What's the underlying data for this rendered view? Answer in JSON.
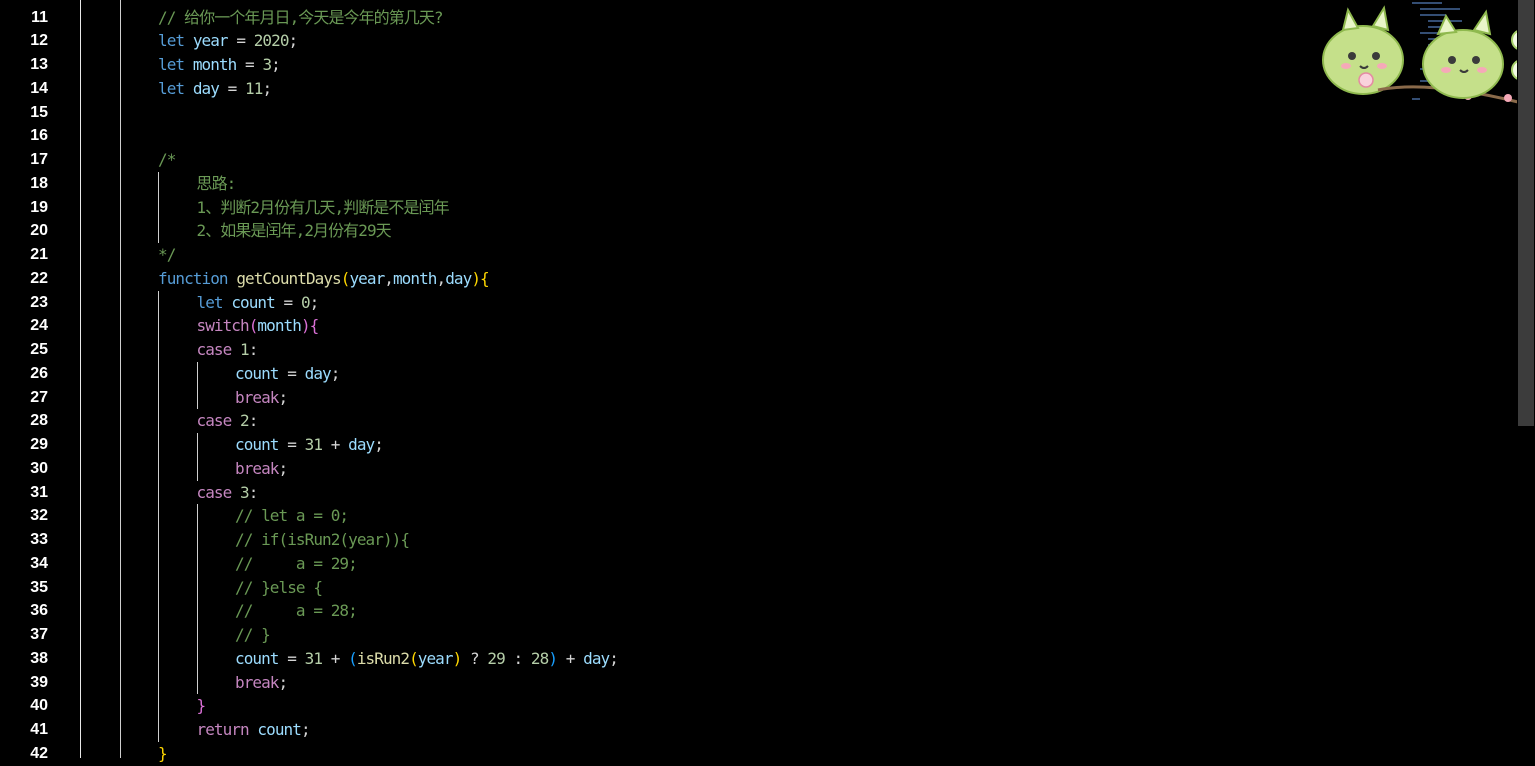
{
  "editor": {
    "line_numbers": [
      "11",
      "12",
      "13",
      "14",
      "15",
      "16",
      "17",
      "18",
      "19",
      "20",
      "21",
      "22",
      "23",
      "24",
      "25",
      "26",
      "27",
      "28",
      "29",
      "30",
      "31",
      "32",
      "33",
      "34",
      "35",
      "36",
      "37",
      "38",
      "39",
      "40",
      "41",
      "42"
    ],
    "lines": [
      {
        "indent": 2,
        "tokens": [
          {
            "t": "cm",
            "v": "// 给你一个年月日,今天是今年的第几天?"
          }
        ]
      },
      {
        "indent": 2,
        "tokens": [
          {
            "t": "kw",
            "v": "let"
          },
          {
            "t": "pl",
            "v": " "
          },
          {
            "t": "var",
            "v": "year"
          },
          {
            "t": "op",
            "v": " = "
          },
          {
            "t": "num",
            "v": "2020"
          },
          {
            "t": "op",
            "v": ";"
          }
        ]
      },
      {
        "indent": 2,
        "tokens": [
          {
            "t": "kw",
            "v": "let"
          },
          {
            "t": "pl",
            "v": " "
          },
          {
            "t": "var",
            "v": "month"
          },
          {
            "t": "op",
            "v": " = "
          },
          {
            "t": "num",
            "v": "3"
          },
          {
            "t": "op",
            "v": ";"
          }
        ]
      },
      {
        "indent": 2,
        "tokens": [
          {
            "t": "kw",
            "v": "let"
          },
          {
            "t": "pl",
            "v": " "
          },
          {
            "t": "var",
            "v": "day"
          },
          {
            "t": "op",
            "v": " = "
          },
          {
            "t": "num",
            "v": "11"
          },
          {
            "t": "op",
            "v": ";"
          }
        ]
      },
      {
        "indent": 0,
        "tokens": []
      },
      {
        "indent": 0,
        "tokens": []
      },
      {
        "indent": 2,
        "tokens": [
          {
            "t": "cm",
            "v": "/*"
          }
        ]
      },
      {
        "indent": 3,
        "tokens": [
          {
            "t": "cm",
            "v": "思路:"
          }
        ]
      },
      {
        "indent": 3,
        "tokens": [
          {
            "t": "cm",
            "v": "1、判断2月份有几天,判断是不是闰年"
          }
        ]
      },
      {
        "indent": 3,
        "tokens": [
          {
            "t": "cm",
            "v": "2、如果是闰年,2月份有29天"
          }
        ]
      },
      {
        "indent": 2,
        "tokens": [
          {
            "t": "cm",
            "v": "*/"
          }
        ]
      },
      {
        "indent": 2,
        "tokens": [
          {
            "t": "kw",
            "v": "function"
          },
          {
            "t": "pl",
            "v": " "
          },
          {
            "t": "fn",
            "v": "getCountDays"
          },
          {
            "t": "b1",
            "v": "("
          },
          {
            "t": "var",
            "v": "year"
          },
          {
            "t": "op",
            "v": ","
          },
          {
            "t": "var",
            "v": "month"
          },
          {
            "t": "op",
            "v": ","
          },
          {
            "t": "var",
            "v": "day"
          },
          {
            "t": "b1",
            "v": ")"
          },
          {
            "t": "b1",
            "v": "{"
          }
        ]
      },
      {
        "indent": 3,
        "tokens": [
          {
            "t": "kw",
            "v": "let"
          },
          {
            "t": "pl",
            "v": " "
          },
          {
            "t": "var",
            "v": "count"
          },
          {
            "t": "op",
            "v": " = "
          },
          {
            "t": "num",
            "v": "0"
          },
          {
            "t": "op",
            "v": ";"
          }
        ]
      },
      {
        "indent": 3,
        "tokens": [
          {
            "t": "ctl",
            "v": "switch"
          },
          {
            "t": "b2",
            "v": "("
          },
          {
            "t": "var",
            "v": "month"
          },
          {
            "t": "b2",
            "v": ")"
          },
          {
            "t": "b2",
            "v": "{"
          }
        ]
      },
      {
        "indent": 3,
        "tokens": [
          {
            "t": "ctl",
            "v": "case"
          },
          {
            "t": "pl",
            "v": " "
          },
          {
            "t": "num",
            "v": "1"
          },
          {
            "t": "op",
            "v": ":"
          }
        ]
      },
      {
        "indent": 4,
        "tokens": [
          {
            "t": "var",
            "v": "count"
          },
          {
            "t": "op",
            "v": " = "
          },
          {
            "t": "var",
            "v": "day"
          },
          {
            "t": "op",
            "v": ";"
          }
        ]
      },
      {
        "indent": 4,
        "tokens": [
          {
            "t": "ctl",
            "v": "break"
          },
          {
            "t": "op",
            "v": ";"
          }
        ]
      },
      {
        "indent": 3,
        "tokens": [
          {
            "t": "ctl",
            "v": "case"
          },
          {
            "t": "pl",
            "v": " "
          },
          {
            "t": "num",
            "v": "2"
          },
          {
            "t": "op",
            "v": ":"
          }
        ]
      },
      {
        "indent": 4,
        "tokens": [
          {
            "t": "var",
            "v": "count"
          },
          {
            "t": "op",
            "v": " = "
          },
          {
            "t": "num",
            "v": "31"
          },
          {
            "t": "op",
            "v": " + "
          },
          {
            "t": "var",
            "v": "day"
          },
          {
            "t": "op",
            "v": ";"
          }
        ]
      },
      {
        "indent": 4,
        "tokens": [
          {
            "t": "ctl",
            "v": "break"
          },
          {
            "t": "op",
            "v": ";"
          }
        ]
      },
      {
        "indent": 3,
        "tokens": [
          {
            "t": "ctl",
            "v": "case"
          },
          {
            "t": "pl",
            "v": " "
          },
          {
            "t": "num",
            "v": "3"
          },
          {
            "t": "op",
            "v": ":"
          }
        ]
      },
      {
        "indent": 4,
        "tokens": [
          {
            "t": "cm",
            "v": "// let a = 0;"
          }
        ]
      },
      {
        "indent": 4,
        "tokens": [
          {
            "t": "cm",
            "v": "// if(isRun2(year)){"
          }
        ]
      },
      {
        "indent": 4,
        "tokens": [
          {
            "t": "cm",
            "v": "//     a = 29;"
          }
        ]
      },
      {
        "indent": 4,
        "tokens": [
          {
            "t": "cm",
            "v": "// }else {"
          }
        ]
      },
      {
        "indent": 4,
        "tokens": [
          {
            "t": "cm",
            "v": "//     a = 28;"
          }
        ]
      },
      {
        "indent": 4,
        "tokens": [
          {
            "t": "cm",
            "v": "// }"
          }
        ]
      },
      {
        "indent": 4,
        "tokens": [
          {
            "t": "var",
            "v": "count"
          },
          {
            "t": "op",
            "v": " = "
          },
          {
            "t": "num",
            "v": "31"
          },
          {
            "t": "op",
            "v": " + "
          },
          {
            "t": "b3",
            "v": "("
          },
          {
            "t": "fn",
            "v": "isRun2"
          },
          {
            "t": "b1",
            "v": "("
          },
          {
            "t": "var",
            "v": "year"
          },
          {
            "t": "b1",
            "v": ")"
          },
          {
            "t": "op",
            "v": " ? "
          },
          {
            "t": "num",
            "v": "29"
          },
          {
            "t": "op",
            "v": " : "
          },
          {
            "t": "num",
            "v": "28"
          },
          {
            "t": "b3",
            "v": ")"
          },
          {
            "t": "op",
            "v": " + "
          },
          {
            "t": "var",
            "v": "day"
          },
          {
            "t": "op",
            "v": ";"
          }
        ]
      },
      {
        "indent": 4,
        "tokens": [
          {
            "t": "ctl",
            "v": "break"
          },
          {
            "t": "op",
            "v": ";"
          }
        ]
      },
      {
        "indent": 3,
        "tokens": [
          {
            "t": "b2",
            "v": "}"
          }
        ]
      },
      {
        "indent": 3,
        "tokens": [
          {
            "t": "ctl",
            "v": "return"
          },
          {
            "t": "pl",
            "v": " "
          },
          {
            "t": "var",
            "v": "count"
          },
          {
            "t": "op",
            "v": ";"
          }
        ]
      },
      {
        "indent": 2,
        "tokens": [
          {
            "t": "b1",
            "v": "}"
          }
        ]
      }
    ]
  },
  "mascot": {
    "icon": "green-dragon-mascot-icon",
    "buttons": [
      {
        "name": "mascot-refresh-button",
        "glyph": "↻"
      },
      {
        "name": "mascot-dress-button",
        "glyph": "✿"
      }
    ]
  },
  "colors": {
    "background": "#000000",
    "line_number": "#ffffff",
    "keyword": "#569cd6",
    "control": "#c586c0",
    "variable": "#9cdcfe",
    "function": "#dcdcaa",
    "number": "#b5cea8",
    "comment": "#6a9955",
    "bracket_1": "#ffd700",
    "bracket_2": "#da70d6",
    "bracket_3": "#179fff"
  }
}
